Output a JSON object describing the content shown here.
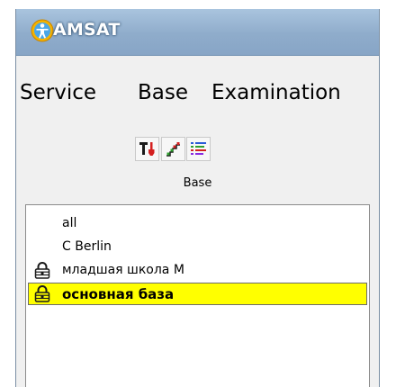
{
  "app": {
    "title": "AMSAT",
    "logo_icon": "person-logo-icon"
  },
  "menu": {
    "items": [
      "Service",
      "Base",
      "Examination"
    ]
  },
  "toolbar": {
    "group_label": "Base",
    "buttons": [
      {
        "icon": "tools-icon"
      },
      {
        "icon": "stairs-chart-icon"
      },
      {
        "icon": "color-list-icon"
      }
    ]
  },
  "bases": {
    "items": [
      {
        "label": "all",
        "locked": false,
        "selected": false
      },
      {
        "label": "C Berlin",
        "locked": false,
        "selected": false
      },
      {
        "label": "младшая школа М",
        "locked": true,
        "selected": false
      },
      {
        "label": "основная база",
        "locked": true,
        "selected": true
      }
    ]
  },
  "colors": {
    "selection": "#ffff00",
    "titlebar": "#8faccb"
  }
}
